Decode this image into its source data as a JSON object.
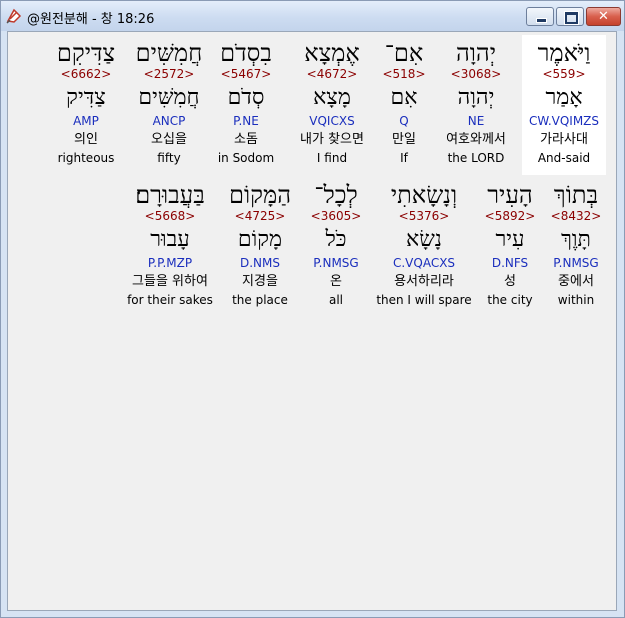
{
  "window": {
    "title": "@원전분해 - 창 18:26",
    "close_glyph": "✕"
  },
  "rows": [
    {
      "words": [
        {
          "hebrew": "וַיֹּאמֶר",
          "strong": "<559>",
          "lexeme": "אָמַר",
          "parse": "CW.VQIMZS",
          "korean": "가라사대",
          "english": "And-said",
          "highlighted": true
        },
        {
          "hebrew": "יְהוָה",
          "strong": "<3068>",
          "lexeme": "יְהוָה",
          "parse": "NE",
          "korean": "여호와께서",
          "english": "the LORD"
        },
        {
          "hebrew": "אִם־",
          "strong": "<518>",
          "lexeme": "אִם",
          "parse": "Q",
          "korean": "만일",
          "english": "If"
        },
        {
          "hebrew": "אֶמְצָא",
          "strong": "<4672>",
          "lexeme": "מָצָא",
          "parse": "VQICXS",
          "korean": "내가 찾으면",
          "english": "I find"
        },
        {
          "hebrew": "בִסְדֹם",
          "strong": "<5467>",
          "lexeme": "סְדֹם",
          "parse": "P.NE",
          "korean": "소돔",
          "english": "in Sodom"
        },
        {
          "hebrew": "חֲמִשִּׁים",
          "strong": "<2572>",
          "lexeme": "חֲמִשִּׁים",
          "parse": "ANCP",
          "korean": "오십을",
          "english": "fifty"
        },
        {
          "hebrew": "צַדִּיקִם",
          "strong": "<6662>",
          "lexeme": "צַדִּיק",
          "parse": "AMP",
          "korean": "의인",
          "english": "righteous"
        }
      ]
    },
    {
      "words": [
        {
          "hebrew": "בְּתוֹךְ",
          "strong": "<8432>",
          "lexeme": "תָּוֶךְ",
          "parse": "P.NMSG",
          "korean": "중에서",
          "english": "within"
        },
        {
          "hebrew": "הָעִיר",
          "strong": "<5892>",
          "lexeme": "עִיר",
          "parse": "D.NFS",
          "korean": "성",
          "english": "the city"
        },
        {
          "hebrew": "וְנָשָׂאתִי",
          "strong": "<5376>",
          "lexeme": "נָשָׂא",
          "parse": "C.VQACXS",
          "korean": "용서하리라",
          "english": "then I will spare"
        },
        {
          "hebrew": "לְכָל־",
          "strong": "<3605>",
          "lexeme": "כֹּל",
          "parse": "P.NMSG",
          "korean": "온",
          "english": "all"
        },
        {
          "hebrew": "הַמָּקוֹם",
          "strong": "<4725>",
          "lexeme": "מָקוֹם",
          "parse": "D.NMS",
          "korean": "지경을",
          "english": "the place"
        },
        {
          "hebrew": "בַּעֲבוּרָם׃",
          "strong": "<5668>",
          "lexeme": "עָבוּר",
          "parse": "P.P.MZP",
          "korean": "그들을 위하여",
          "english": "for their sakes"
        }
      ]
    }
  ],
  "colors": {
    "strong": "#8b0000",
    "parse": "#1a2ebd",
    "highlight": "#ffffff"
  }
}
